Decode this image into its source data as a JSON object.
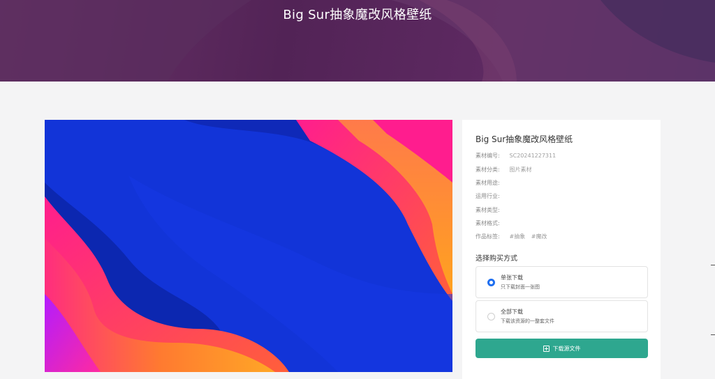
{
  "header": {
    "title": "Big Sur抽象魔改风格壁纸"
  },
  "artwork": {
    "name": "abstract-big-sur-wallpaper"
  },
  "info": {
    "title": "Big Sur抽象魔改风格壁纸",
    "meta": [
      {
        "label": "素材编号:",
        "value": "SC20241227311"
      },
      {
        "label": "素材分类:",
        "value": "图片素材"
      },
      {
        "label": "素材用途:",
        "value": ""
      },
      {
        "label": "运用行业:",
        "value": ""
      },
      {
        "label": "素材类型:",
        "value": ""
      },
      {
        "label": "素材格式:",
        "value": ""
      }
    ],
    "tags_label": "作品标签:",
    "tags": [
      "#抽象",
      "#魔改"
    ]
  },
  "purchase": {
    "heading": "选择购买方式",
    "options": [
      {
        "title": "单张下载",
        "desc": "只下载封面一张图",
        "selected": true
      },
      {
        "title": "全部下载",
        "desc": "下载该资源的一整套文件",
        "selected": false
      }
    ],
    "download_label": "下载源文件"
  },
  "colors": {
    "banner": "#522356",
    "accent": "#2ea78f",
    "radio_selected": "#1f6ff0"
  }
}
